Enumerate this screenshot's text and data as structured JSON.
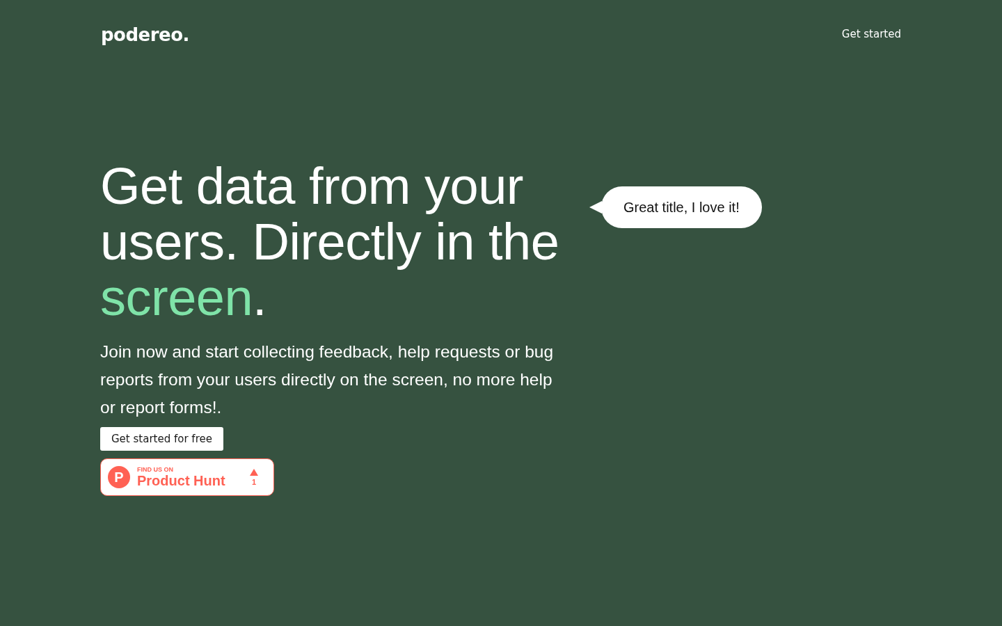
{
  "header": {
    "logo": "podereo.",
    "nav_link": "Get started"
  },
  "hero": {
    "headline": {
      "text": "Get data from your users. Directly in the",
      "highlight": "screen",
      "end": "."
    },
    "description": "Join now and start collecting feedback, help requests or bug reports from your users directly on the screen, no more help or report forms!.",
    "cta_button": "Get started for free",
    "product_hunt_badge": {
      "logo_letter": "P",
      "eyebrow": "FIND US ON",
      "name": "Product Hunt",
      "upvotes": "1"
    },
    "comment_bubble": "Great title, I love it!"
  }
}
